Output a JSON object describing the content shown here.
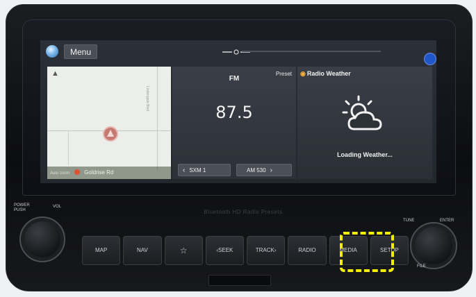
{
  "app": {
    "menu_label": "Menu"
  },
  "map": {
    "road_label": "Lindengate Blvd",
    "zoom_text": "Auto zoom",
    "location_name": "Goldrise Rd"
  },
  "radio": {
    "band": "FM",
    "preset_label": "Preset",
    "frequency": "87.5",
    "prev_station": "SXM 1",
    "next_station": "AM 530"
  },
  "weather": {
    "title": "Radio Weather",
    "status": "Loading Weather..."
  },
  "hardware": {
    "power_label": "POWER\nPUSH",
    "vol_label": "VOL",
    "tune_label": "TUNE",
    "enter_label": "ENTER",
    "file_label": "FILE",
    "brand_text": "Bluetooth  HD Radio  Presets",
    "buttons": [
      "MAP",
      "NAV",
      "☆",
      "‹SEEK",
      "TRACK›",
      "RADIO",
      "MEDIA",
      "SETUP"
    ]
  },
  "colors": {
    "highlight": "#f2f000",
    "notify": "#2057c8"
  }
}
